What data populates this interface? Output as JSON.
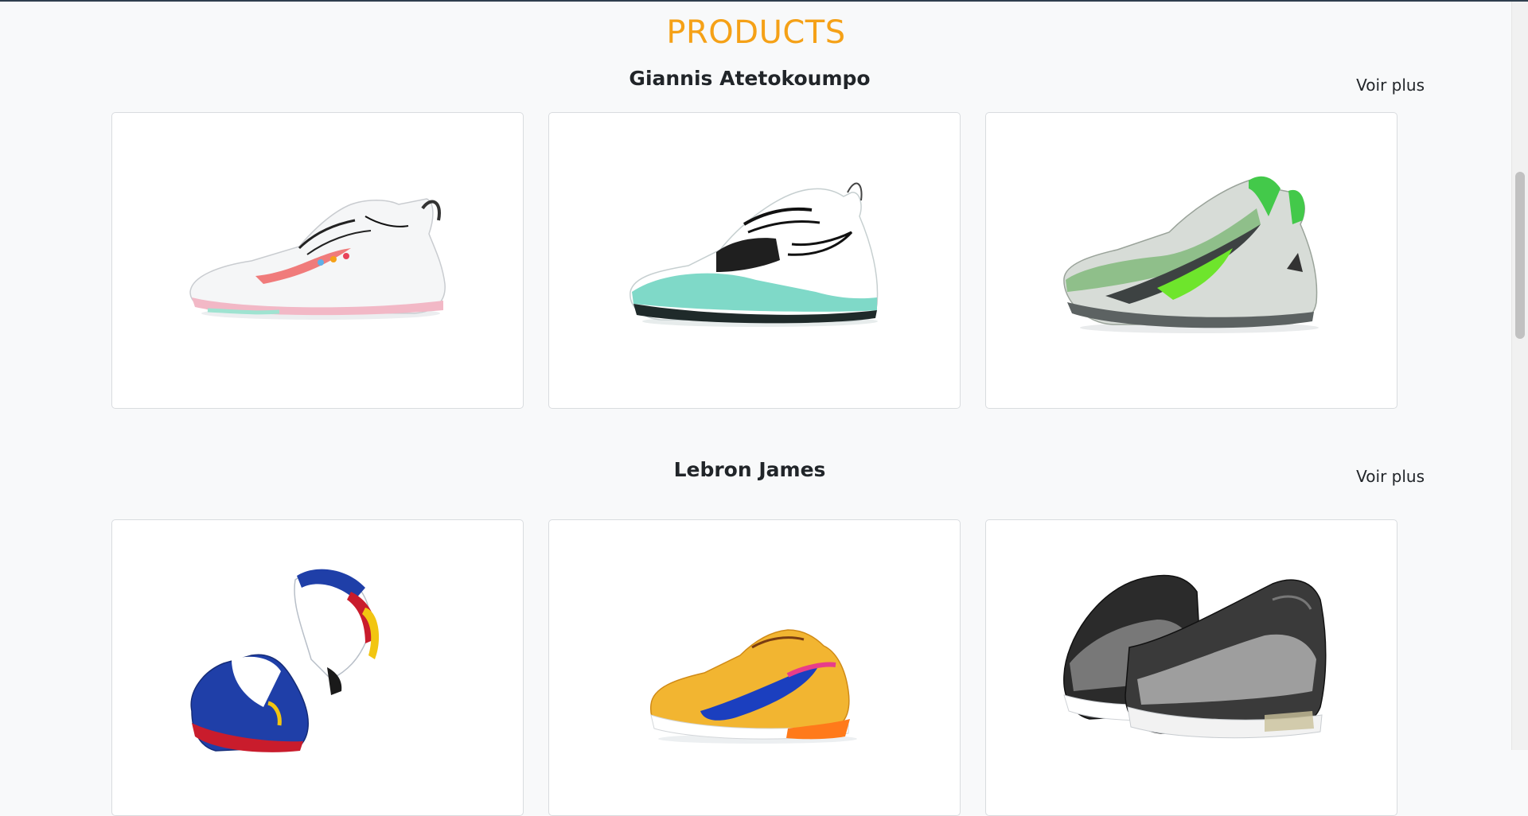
{
  "page": {
    "title": "PRODUCTS",
    "accent_color": "#f5a117"
  },
  "sections": [
    {
      "title": "Giannis Atetokoumpo",
      "more_label": "Voir plus",
      "products": [
        {
          "image": "white-multicolor-sneaker"
        },
        {
          "image": "teal-white-sneaker"
        },
        {
          "image": "green-camo-sneaker"
        }
      ]
    },
    {
      "title": "Lebron James",
      "more_label": "Voir plus",
      "products": [
        {
          "image": "blue-red-yellow-pair-sneaker"
        },
        {
          "image": "orange-yellow-low-sneaker"
        },
        {
          "image": "black-grey-knit-pair-sneaker"
        }
      ]
    }
  ]
}
